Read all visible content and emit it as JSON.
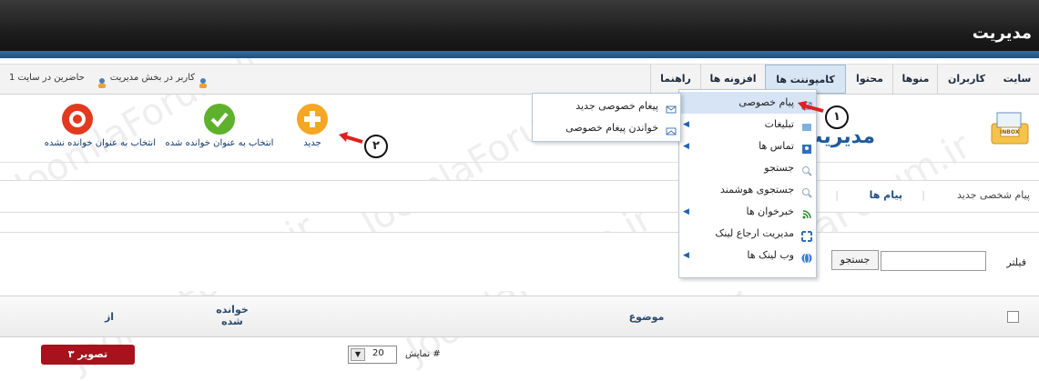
{
  "header": {
    "title": "مدیریت"
  },
  "menubar": {
    "items": [
      "سایت",
      "کاربران",
      "منوها",
      "محتوا",
      "کامپوننت ها",
      "افزونه ها",
      "راهنما"
    ],
    "status": {
      "online_users": "حاضرین در سایت",
      "admin_users": "1 کاربر در بخش مدیریت"
    }
  },
  "component_menu": {
    "items": [
      {
        "label": "پیام خصوصی",
        "has_submenu": false,
        "highlighted": true
      },
      {
        "label": "تبلیغات",
        "has_submenu": true
      },
      {
        "label": "تماس ها",
        "has_submenu": true
      },
      {
        "label": "جستجو",
        "has_submenu": false
      },
      {
        "label": "جستجوی هوشمند",
        "has_submenu": false
      },
      {
        "label": "خبرخوان ها",
        "has_submenu": true
      },
      {
        "label": "مدیریت ارجاع لینک",
        "has_submenu": false
      },
      {
        "label": "وب لینک ها",
        "has_submenu": true
      }
    ]
  },
  "messages_submenu": {
    "items": [
      "پیغام خصوصی جدید",
      "خواندن پیغام خصوصی"
    ]
  },
  "annotations": {
    "one": "۱",
    "two": "۲"
  },
  "page": {
    "title": "مدیریت پیغام ها",
    "inbox_label": "INBOX"
  },
  "toolbar": {
    "new_label": "جدید",
    "mark_read_label": "انتخاب به عنوان خوانده شده",
    "mark_unread_label": "انتخاب به عنوان خوانده نشده"
  },
  "subtabs": {
    "new_message": "پیام شخصی جدید",
    "messages": "پیام ها"
  },
  "filter": {
    "label": "فیلتر",
    "search_button": "جستجو"
  },
  "table": {
    "columns": {
      "subject": "موضوع",
      "read_line1": "خوانده",
      "read_line2": "شده",
      "from": "از"
    }
  },
  "pagination": {
    "display_label": "نمایش #",
    "limit_value": "20"
  },
  "figure_badge": "تصویر ۳",
  "watermark": "JoomlaForum.ir",
  "colors": {
    "header_dark": "#1b1b1b",
    "accent_blue": "#1f5b9a",
    "new_orange": "#f5a623",
    "read_green": "#5fb12d",
    "unread_red": "#e2391f",
    "annotation_red": "#e02020"
  }
}
